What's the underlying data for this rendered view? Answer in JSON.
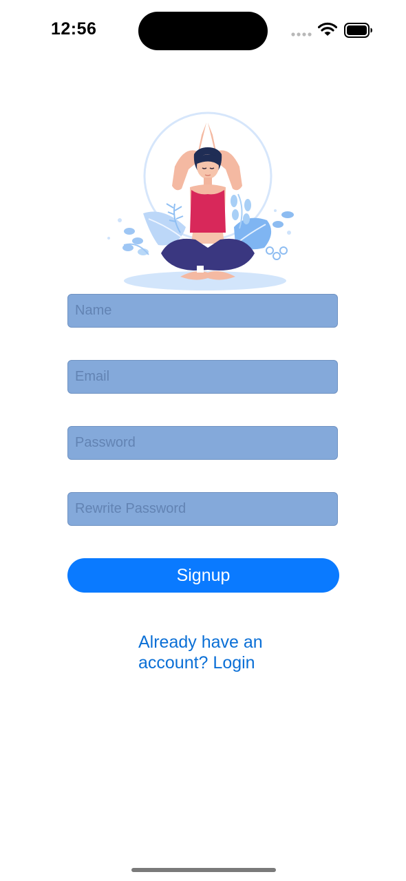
{
  "status_bar": {
    "time": "12:56"
  },
  "form": {
    "name_placeholder": "Name",
    "email_placeholder": "Email",
    "password_placeholder": "Password",
    "rewrite_password_placeholder": "Rewrite Password"
  },
  "signup_button_label": "Signup",
  "login_link": {
    "line1": "Already have an",
    "line2": "account? Login"
  },
  "colors": {
    "field_background": "#84a9da",
    "primary_button": "#0a7aff",
    "link": "#0a6fd6"
  }
}
